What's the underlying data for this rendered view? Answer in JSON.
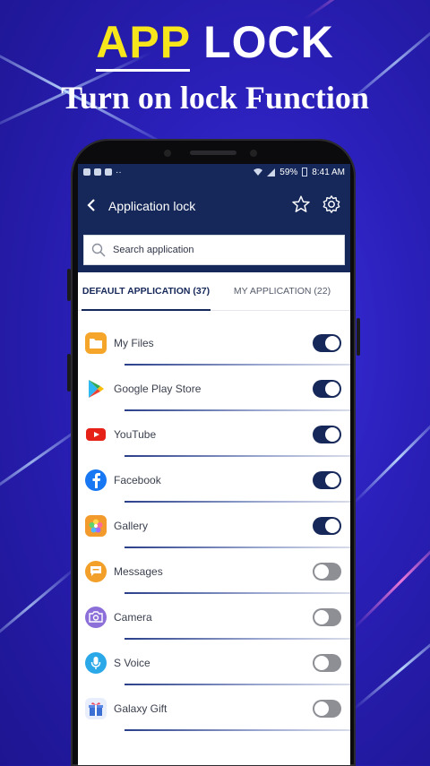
{
  "promo": {
    "title_word1": "APP",
    "title_word2": "LOCK",
    "subtitle": "Turn on lock Function"
  },
  "status_bar": {
    "battery": "59%",
    "time": "8:41 AM"
  },
  "app_bar": {
    "back_icon": "chevron-left-icon",
    "title": "Application lock",
    "star_icon": "star-icon",
    "settings_icon": "gear-icon"
  },
  "search": {
    "placeholder": "Search application",
    "icon": "search-icon"
  },
  "tabs": [
    {
      "label": "DEFAULT APPLICATION (37)",
      "active": true
    },
    {
      "label": "MY APPLICATION (22)",
      "active": false
    }
  ],
  "apps": [
    {
      "name": "My Files",
      "icon": "folder-icon",
      "color": "#f5a62a",
      "locked": true
    },
    {
      "name": "Google Play Store",
      "icon": "play-store-icon",
      "color": "#34a853",
      "locked": true
    },
    {
      "name": "YouTube",
      "icon": "youtube-icon",
      "color": "#e62117",
      "locked": true
    },
    {
      "name": "Facebook",
      "icon": "facebook-icon",
      "color": "#1877f2",
      "locked": true
    },
    {
      "name": "Gallery",
      "icon": "gallery-flower-icon",
      "color": "#f39a2c",
      "locked": true
    },
    {
      "name": "Messages",
      "icon": "message-bubble-icon",
      "color": "#f2a02a",
      "locked": false
    },
    {
      "name": "Camera",
      "icon": "camera-icon",
      "color": "#8c6fd8",
      "locked": false
    },
    {
      "name": "S Voice",
      "icon": "microphone-icon",
      "color": "#2aa8e8",
      "locked": false
    },
    {
      "name": "Galaxy Gift",
      "icon": "gift-icon",
      "color": "#3b6fd4",
      "locked": false
    }
  ],
  "colors": {
    "brand_navy": "#16285a",
    "promo_yellow": "#f6e61b"
  }
}
